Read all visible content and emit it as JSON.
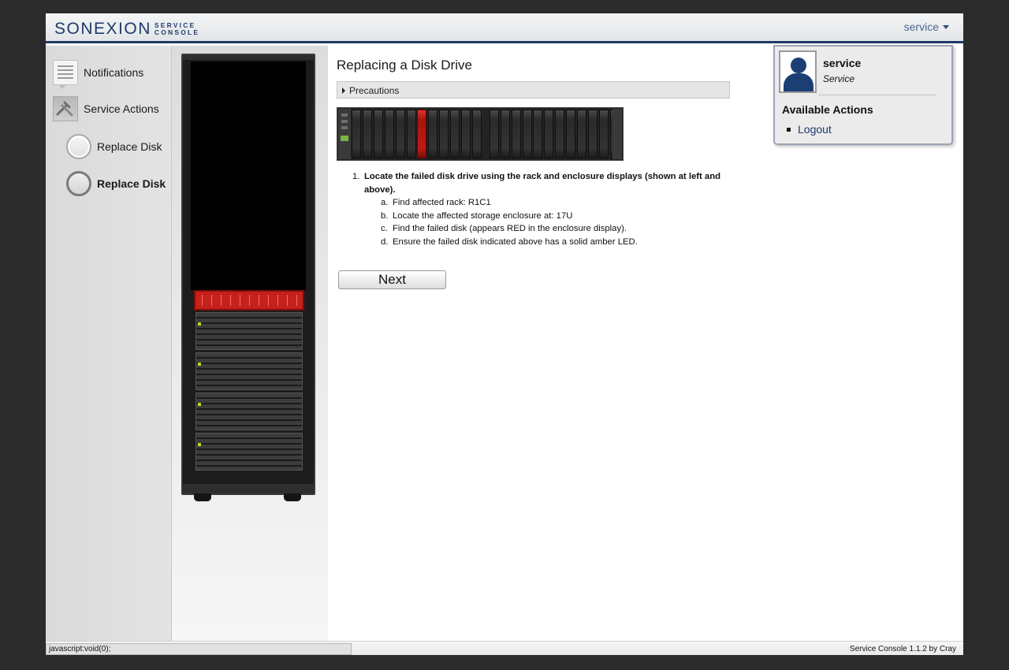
{
  "header": {
    "logo_main": "SONEXION",
    "logo_sub_line1": "SERVICE",
    "logo_sub_line2": "CONSOLE",
    "user_menu_label": "service"
  },
  "nav": {
    "notifications": "Notifications",
    "service_actions": "Service Actions",
    "replace_disk_1": "Replace Disk",
    "replace_disk_2": "Replace Disk"
  },
  "main": {
    "title": "Replacing a Disk Drive",
    "precautions": "Precautions",
    "step_number": "1.",
    "step_heading": "Locate the failed disk drive using the rack and enclosure displays (shown at left and above).",
    "substeps": [
      {
        "letter": "a.",
        "text": "Find affected rack: R1C1"
      },
      {
        "letter": "b.",
        "text": "Locate the affected storage enclosure at: 17U"
      },
      {
        "letter": "c.",
        "text": "Find the failed disk (appears RED in the enclosure display)."
      },
      {
        "letter": "d.",
        "text": "Ensure the failed disk indicated above has a solid amber LED."
      }
    ],
    "next_label": "Next"
  },
  "enclosure": {
    "disk_count": 24,
    "failed_disk_index": 6
  },
  "user_popup": {
    "name": "service",
    "role": "Service",
    "actions_title": "Available Actions",
    "logout": "Logout"
  },
  "footer": {
    "status_url": "javascript:void(0);",
    "version": "Service Console 1.1.2 by Cray"
  },
  "colors": {
    "brand": "#1f3b6a",
    "failed": "#c5211c",
    "header_rule": "#1d3a66"
  }
}
